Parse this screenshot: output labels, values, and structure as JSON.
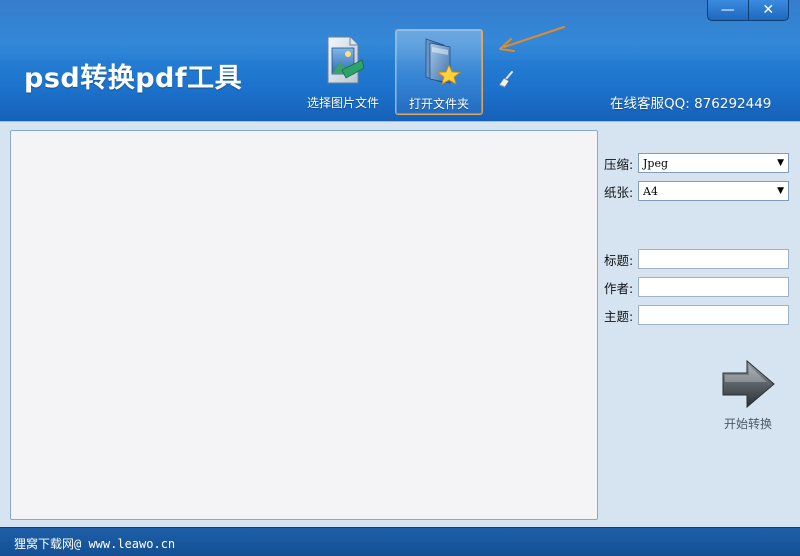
{
  "window": {
    "title": "psd转换pdf工具",
    "minimize_glyph": "—",
    "close_glyph": "✕"
  },
  "toolbar": {
    "select_images_label": "选择图片文件",
    "open_folder_label": "打开文件夹",
    "select_images_icon": "image-file-icon",
    "open_folder_icon": "folder-star-icon",
    "clear_icon": "broom-icon"
  },
  "header": {
    "contact": "在线客服QQ: 876292449"
  },
  "settings": {
    "compression_label": "压缩:",
    "compression_value": "Jpeg",
    "paper_label": "纸张:",
    "paper_value": "A4",
    "title_label": "标题:",
    "title_value": "",
    "author_label": "作者:",
    "author_value": "",
    "subject_label": "主题:",
    "subject_value": ""
  },
  "actions": {
    "start_label": "开始转换",
    "start_icon": "arrow-right-icon"
  },
  "footer": {
    "text": "狸窝下载网@ www.leawo.cn"
  },
  "colors": {
    "header_blue": "#1e74cd",
    "body_bg": "#d6e4f2",
    "annotation_orange": "#e08a2c"
  }
}
